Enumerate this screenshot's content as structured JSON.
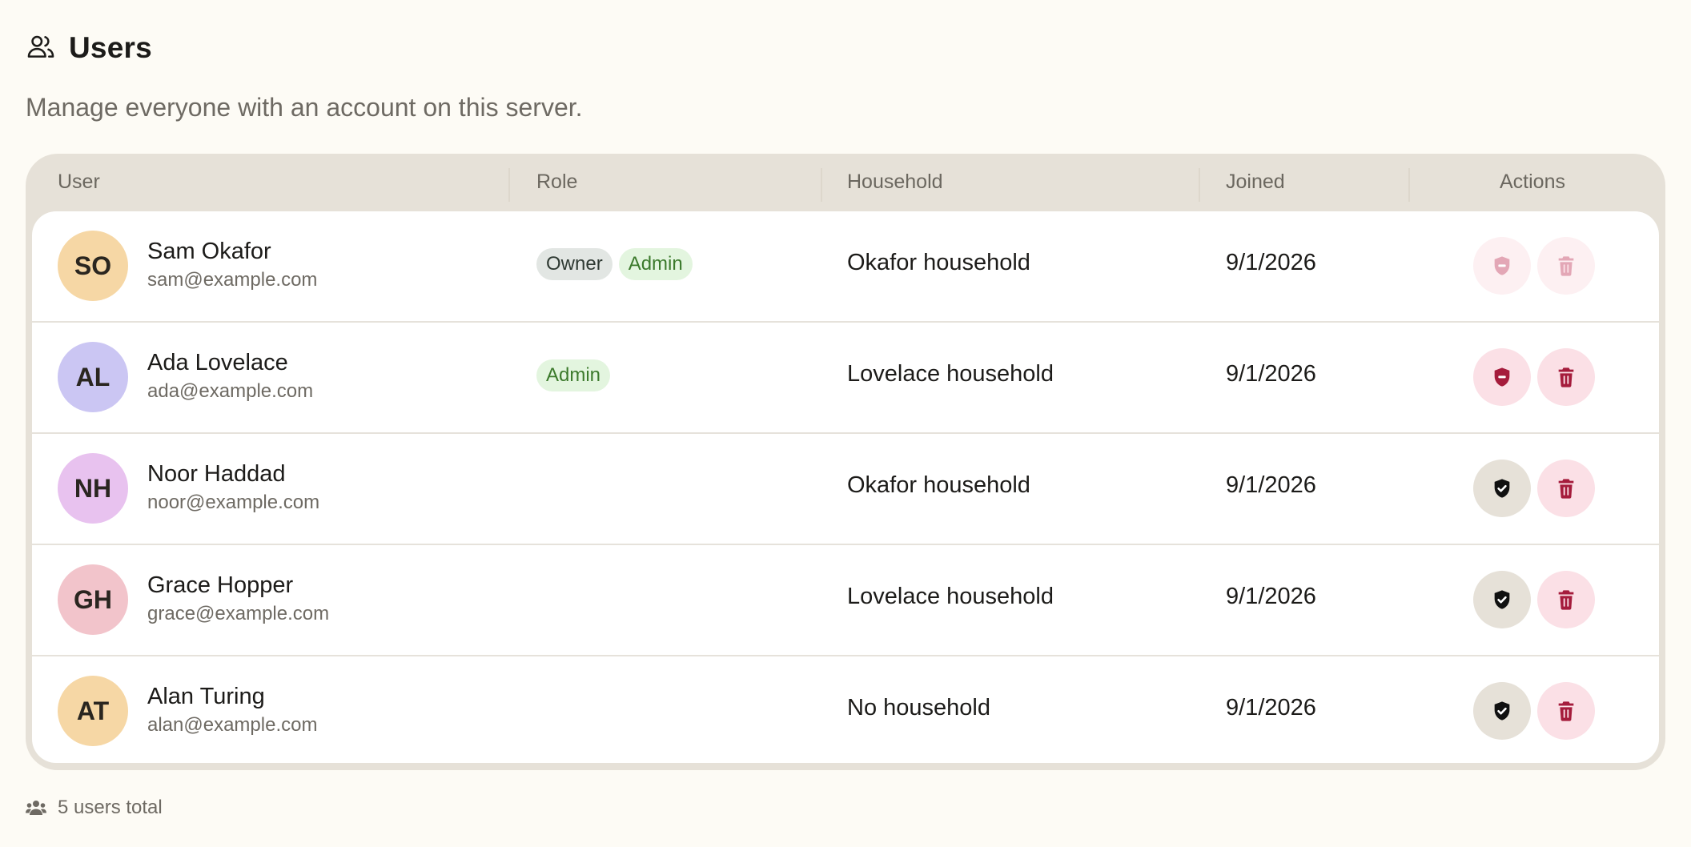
{
  "header": {
    "title": "Users",
    "icon": "users-icon"
  },
  "subtitle": "Manage everyone with an account on this server.",
  "table": {
    "columns": [
      "User",
      "Role",
      "Household",
      "Joined",
      "Actions"
    ],
    "rows": [
      {
        "initials": "SO",
        "avatar_color": "#f6d7a5",
        "name": "Sam Okafor",
        "email": "sam@example.com",
        "roles": [
          "Owner",
          "Admin"
        ],
        "household": "Okafor household",
        "joined": "9/1/2026",
        "shield_state": "demote-disabled",
        "delete_state": "disabled"
      },
      {
        "initials": "AL",
        "avatar_color": "#cbc6f3",
        "name": "Ada Lovelace",
        "email": "ada@example.com",
        "roles": [
          "Admin"
        ],
        "household": "Lovelace household",
        "joined": "9/1/2026",
        "shield_state": "demote",
        "delete_state": "enabled"
      },
      {
        "initials": "NH",
        "avatar_color": "#e8c2ef",
        "name": "Noor Haddad",
        "email": "noor@example.com",
        "roles": [],
        "household": "Okafor household",
        "joined": "9/1/2026",
        "shield_state": "promote",
        "delete_state": "enabled"
      },
      {
        "initials": "GH",
        "avatar_color": "#f2c4cb",
        "name": "Grace Hopper",
        "email": "grace@example.com",
        "roles": [],
        "household": "Lovelace household",
        "joined": "9/1/2026",
        "shield_state": "promote",
        "delete_state": "enabled"
      },
      {
        "initials": "AT",
        "avatar_color": "#f6d7a5",
        "name": "Alan Turing",
        "email": "alan@example.com",
        "roles": [],
        "household": "No household",
        "joined": "9/1/2026",
        "shield_state": "promote",
        "delete_state": "enabled"
      }
    ]
  },
  "footer": {
    "text": "5 users total",
    "icon": "users-group-icon"
  },
  "colors": {
    "danger": "#a51c3c",
    "admin_badge_text": "#3c7a2c",
    "owner_badge_text": "#2f3a33",
    "page_bg": "#fdfbf5",
    "card_bg": "#e6e1d8"
  }
}
